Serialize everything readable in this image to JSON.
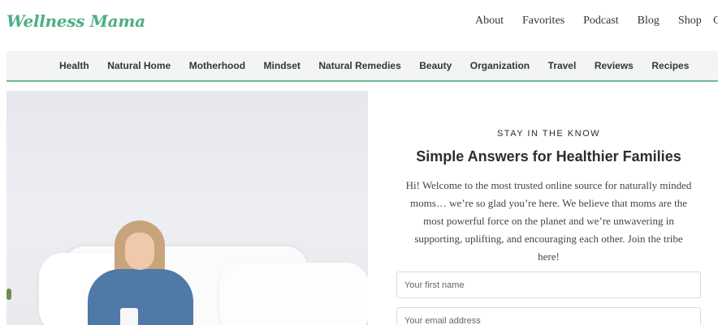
{
  "brand": {
    "logo_text": "Wellness Mama",
    "accent_color": "#4caf85"
  },
  "top_nav": {
    "items": [
      "About",
      "Favorites",
      "Podcast",
      "Blog",
      "Shop"
    ],
    "overflow_glyph": "C"
  },
  "category_nav": {
    "items": [
      "Health",
      "Natural Home",
      "Motherhood",
      "Mindset",
      "Natural Remedies",
      "Beauty",
      "Organization",
      "Travel",
      "Reviews",
      "Recipes"
    ]
  },
  "optin": {
    "eyebrow": "STAY IN THE KNOW",
    "headline": "Simple Answers for Healthier Families",
    "intro": "Hi! Welcome to the most trusted online source for naturally minded moms… we’re so glad you’re here. We believe that moms are the most powerful force on the planet and we’re unwavering in supporting, uplifting, and encouraging each other. Join the tribe here!",
    "first_name_placeholder": "Your first name",
    "email_placeholder": "Your email address"
  }
}
